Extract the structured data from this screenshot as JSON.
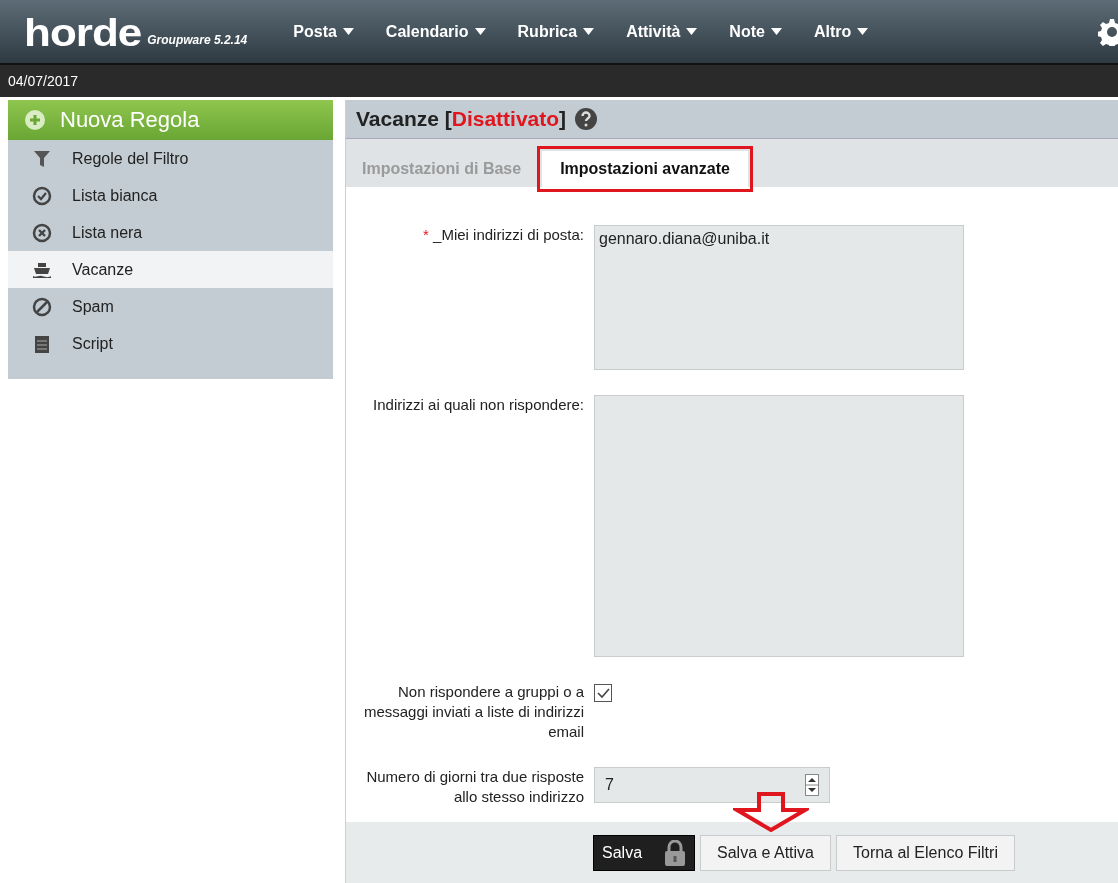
{
  "topbar": {
    "logo": "horde",
    "product": "Groupware 5.2.14",
    "menus": [
      {
        "label": "Posta"
      },
      {
        "label": "Calendario"
      },
      {
        "label": "Rubrica"
      },
      {
        "label": "Attività"
      },
      {
        "label": "Note"
      },
      {
        "label": "Altro"
      }
    ]
  },
  "date": "04/07/2017",
  "sidebar": {
    "new_button": "Nuova Regola",
    "items": [
      {
        "label": "Regole del Filtro",
        "selected": false
      },
      {
        "label": "Lista bianca",
        "selected": false
      },
      {
        "label": "Lista nera",
        "selected": false
      },
      {
        "label": "Vacanze",
        "selected": true
      },
      {
        "label": "Spam",
        "selected": false
      },
      {
        "label": "Script",
        "selected": false
      }
    ]
  },
  "header": {
    "title": "Vacanze",
    "bracket_open": "[",
    "status": "Disattivato",
    "bracket_close": "]"
  },
  "tabs": [
    {
      "label": "Impostazioni di Base",
      "selected": false
    },
    {
      "label": "Impostazioni avanzate",
      "selected": true
    }
  ],
  "form": [
    {
      "kind": "textarea",
      "required": true,
      "required_mark": "*",
      "label": "_Miei indirizzi di posta:",
      "value": "gennaro.diana@uniba.it"
    },
    {
      "kind": "textarea",
      "label": "Indirizzi ai quali non rispondere:"
    },
    {
      "kind": "checkbox",
      "label": "Non rispondere a gruppi o a messaggi inviati a liste di indirizzi email",
      "checked": true
    },
    {
      "kind": "number",
      "label": "Numero di giorni tra due risposte allo stesso indirizzo",
      "value": "7"
    }
  ],
  "buttons": [
    {
      "kind": "dark",
      "label": "Salva"
    },
    {
      "kind": "plain",
      "label": "Salva e Attiva"
    },
    {
      "kind": "plain",
      "label": "Torna al Elenco Filtri"
    }
  ]
}
